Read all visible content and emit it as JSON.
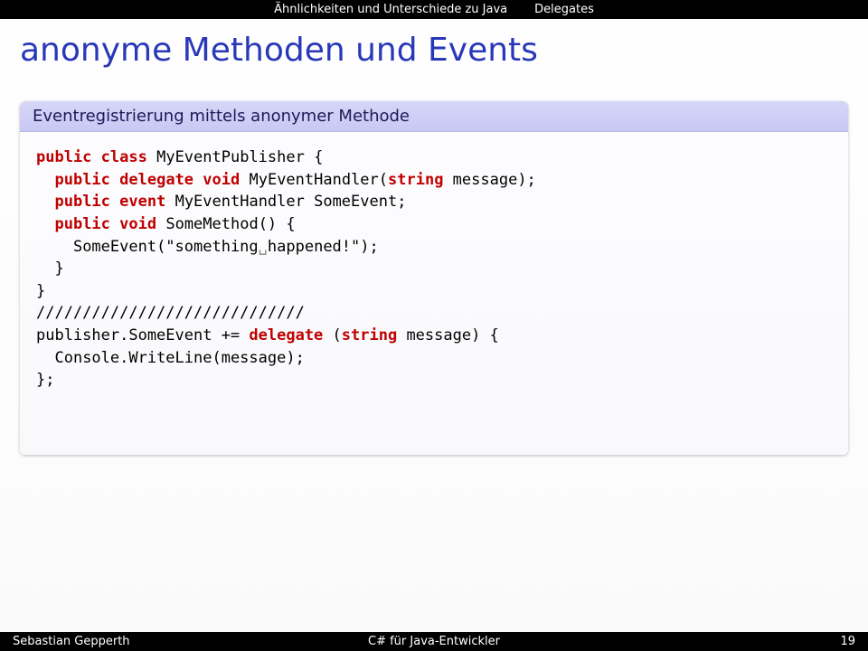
{
  "nav": {
    "section": "Ähnlichkeiten und Unterschiede zu Java",
    "topic": "Delegates"
  },
  "title": "anonyme Methoden und Events",
  "block": {
    "header": "Eventregistrierung mittels anonymer Methode",
    "code": {
      "kw_public1": "public",
      "kw_class": "class",
      "cls_name": " MyEventPublisher {",
      "kw_public2": "public",
      "kw_delegate": "delegate",
      "kw_void1": "void",
      "sig1": " MyEventHandler(",
      "kw_string1": "string",
      "sig1b": " message);",
      "kw_public3": "public",
      "kw_event": "event",
      "sig2": " MyEventHandler SomeEvent;",
      "kw_public4": "public",
      "kw_void2": "void",
      "sig3": " SomeMethod() {",
      "call1a": "SomeEvent(\"something",
      "vis1": "␣",
      "call1b": "happened!\");",
      "close1": "}",
      "close2": "}",
      "divider": "/////////////////////////////",
      "pub": "publisher.SomeEvent += ",
      "kw_delegate2": "delegate",
      "args": " (",
      "kw_string2": "string",
      "argsb": " message) {",
      "body": "Console.WriteLine(message);",
      "close3": "};"
    }
  },
  "footer": {
    "author": "Sebastian Gepperth",
    "talk": "C# für Java-Entwickler",
    "page": "19"
  }
}
